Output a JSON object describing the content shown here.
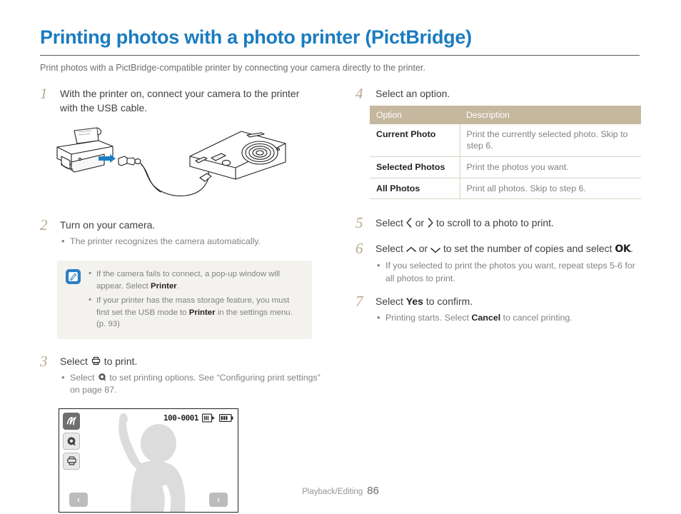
{
  "header": {
    "title": "Printing photos with a photo printer (PictBridge)",
    "subtitle": "Print photos with a PictBridge-compatible printer by connecting your camera directly to the printer."
  },
  "colors": {
    "title_blue": "#1a7cc0",
    "step_number": "#b9aa8e",
    "table_header": "#c5b89f",
    "note_bg": "#f4f2ee",
    "note_icon": "#2b7fc4",
    "body_text": "#414042",
    "muted_text": "#808285"
  },
  "steps": {
    "s1": {
      "number": "1",
      "text_line1": "With the printer on, connect your camera to the printer",
      "text_line2": "with the USB cable."
    },
    "s2": {
      "number": "2",
      "text": "Turn on your camera.",
      "bullet1": "The printer recognizes the camera automatically."
    },
    "s3": {
      "number": "3",
      "text_before_icon": "Select",
      "icon": "printer-icon",
      "text_after_icon": "to print.",
      "bullet1_before_icon": "Select",
      "bullet1_icon": "gear-icon",
      "bullet1_after_icon": "to set printing options. See “Configuring print settings” on page 87."
    },
    "s4": {
      "number": "4",
      "text": "Select an option."
    },
    "s5": {
      "number": "5",
      "text_before": "Select",
      "icon_left": "chevron-left-icon",
      "text_or": "or",
      "icon_right": "chevron-right-icon",
      "text_after": "to scroll to a photo to print."
    },
    "s6": {
      "number": "6",
      "text_before": "Select",
      "icon_up": "chevron-up-icon",
      "text_or": "or",
      "icon_down": "chevron-down-icon",
      "text_after": "to set the number of copies and select",
      "ok_label": "OK",
      "period": ".",
      "bullet1": "If you selected to print the photos you want, repeat steps 5-6 for all photos to print."
    },
    "s7": {
      "number": "7",
      "text_before": "Select",
      "bold": "Yes",
      "text_after": "to confirm.",
      "bullet1_before": "Printing starts. Select",
      "bullet1_bold": "Cancel",
      "bullet1_after": "to cancel printing."
    }
  },
  "note": {
    "icon": "note-pen-icon",
    "items": [
      {
        "before": "If the camera fails to connect, a pop-up window will appear. Select",
        "bold": "Printer",
        "after": "."
      },
      {
        "before": "If your printer has the mass storage feature, you must first set the USB mode to",
        "bold": "Printer",
        "after": "in the settings menu. (p. 93)"
      }
    ]
  },
  "options_table": {
    "headers": [
      "Option",
      "Description"
    ],
    "rows": [
      [
        "Current Photo",
        "Print the currently selected photo. Skip to step 6."
      ],
      [
        "Selected Photos",
        "Print the photos you want."
      ],
      [
        "All Photos",
        "Print all photos. Skip to step 6."
      ]
    ]
  },
  "lcd": {
    "counter": "100-0001",
    "memory_icon": "memory-card-icon",
    "battery_icon": "battery-icon",
    "buttons": [
      "back-icon",
      "gear-icon",
      "printer-icon"
    ],
    "nav_prev": "‹",
    "nav_next": "›"
  },
  "illustration": {
    "name": "printer-camera-usb-illustration",
    "accent_color": "#1f7fc4"
  },
  "footer": {
    "section": "Playback/Editing",
    "page": "86"
  }
}
